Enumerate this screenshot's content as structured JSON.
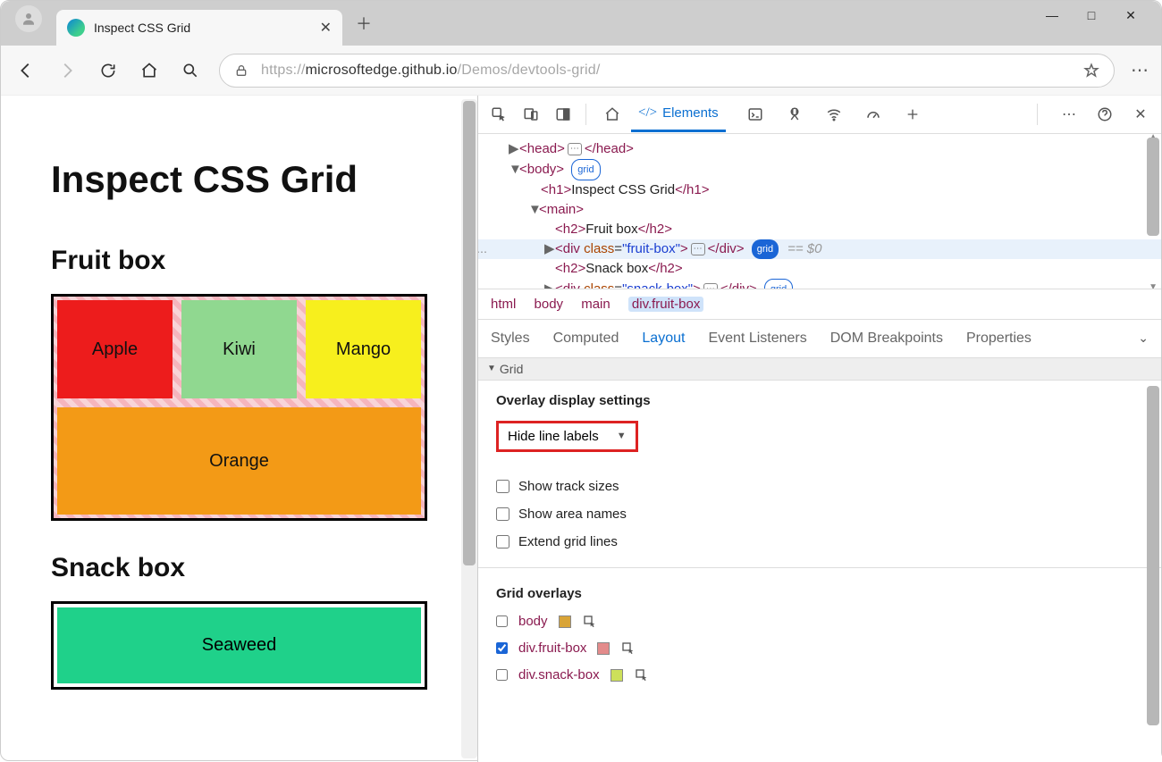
{
  "browser": {
    "tab_title": "Inspect CSS Grid",
    "url_prefix": "https://",
    "url_host": "microsoftedge.github.io",
    "url_path": "/Demos/devtools-grid/"
  },
  "page": {
    "h1": "Inspect CSS Grid",
    "h2_fruit": "Fruit box",
    "h2_snack": "Snack box",
    "cells": {
      "apple": "Apple",
      "kiwi": "Kiwi",
      "mango": "Mango",
      "orange": "Orange",
      "seaweed": "Seaweed"
    }
  },
  "devtools": {
    "top_tabs": {
      "welcome": "",
      "elements": "Elements"
    },
    "dom": {
      "head_open": "<head>",
      "head_close": "</head>",
      "body_open": "<body>",
      "grid_badge": "grid",
      "h1_open": "<h1>",
      "h1_text": "Inspect CSS Grid",
      "h1_close": "</h1>",
      "main_open": "<main>",
      "h2f_open": "<h2>",
      "h2f_text": "Fruit box",
      "h2f_close": "</h2>",
      "div_open": "<div ",
      "class_attr": "class",
      "eq": "=",
      "fruit_val": "\"fruit-box\"",
      "div_gt": ">",
      "div_close": "</div>",
      "h2s_open": "<h2>",
      "h2s_text": "Snack box",
      "h2s_close": "</h2>",
      "snack_val": "\"snack-box\"",
      "eq0": "== $0"
    },
    "breadcrumb": [
      "html",
      "body",
      "main",
      "div.fruit-box"
    ],
    "subtabs": [
      "Styles",
      "Computed",
      "Layout",
      "Event Listeners",
      "DOM Breakpoints",
      "Properties"
    ],
    "grid_section": "Grid",
    "overlay_settings_title": "Overlay display settings",
    "line_labels_select": "Hide line labels",
    "checkboxes": {
      "track": "Show track sizes",
      "area": "Show area names",
      "extend": "Extend grid lines"
    },
    "grid_overlays_title": "Grid overlays",
    "overlays": [
      {
        "name": "body",
        "color": "#d9a437",
        "checked": false
      },
      {
        "name": "div.fruit-box",
        "color": "#e38b8b",
        "checked": true
      },
      {
        "name": "div.snack-box",
        "color": "#cde05a",
        "checked": false
      }
    ]
  }
}
